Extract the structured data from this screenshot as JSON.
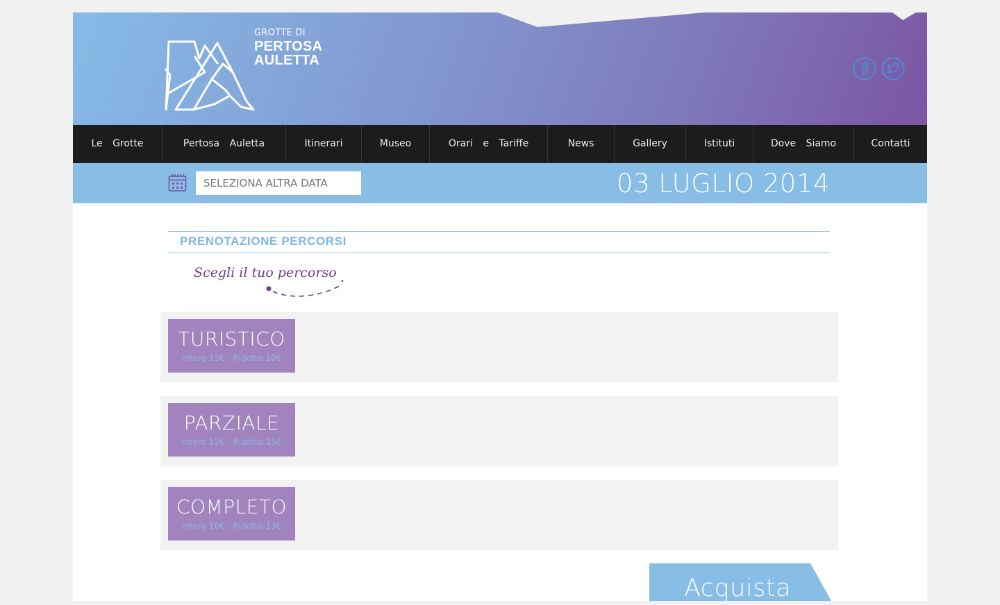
{
  "brand": {
    "line1": "GROTTE DI",
    "line2": "PERTOSA",
    "line3": "AULETTA"
  },
  "social": [
    {
      "icon": "facebook-icon"
    },
    {
      "icon": "twitter-icon"
    }
  ],
  "nav": [
    {
      "label": "Le Grotte"
    },
    {
      "label": "Pertosa Auletta"
    },
    {
      "label": "Itinerari"
    },
    {
      "label": "Museo"
    },
    {
      "label": "Orari e Tariffe"
    },
    {
      "label": "News"
    },
    {
      "label": "Gallery"
    },
    {
      "label": "Istituti"
    },
    {
      "label": "Dove Siamo"
    },
    {
      "label": "Contatti"
    }
  ],
  "datebar": {
    "placeholder": "SELEZIONA ALTRA DATA",
    "current_date": "03 LUGLIO 2014"
  },
  "booking": {
    "title": "PRENOTAZIONE PERCORSI",
    "subtitle": "Scegli il tuo percorso"
  },
  "routes": [
    {
      "name": "TURISTICO",
      "price": "Intero 13€ - Ridotto 10€"
    },
    {
      "name": "PARZIALE",
      "price": "Intero 13€ - Ridotto 15€"
    },
    {
      "name": "COMPLETO",
      "price": "Intero 16€ - Ridotto 13€"
    }
  ],
  "buy": {
    "label": "Acquista"
  },
  "colors": {
    "header_start": "#86bbe6",
    "header_end": "#7b55a3",
    "nav_bg": "#1c1c1c",
    "datebar_bg": "#88bde6",
    "route_card": "#a183bd",
    "accent_blue": "#7fb6e2"
  }
}
